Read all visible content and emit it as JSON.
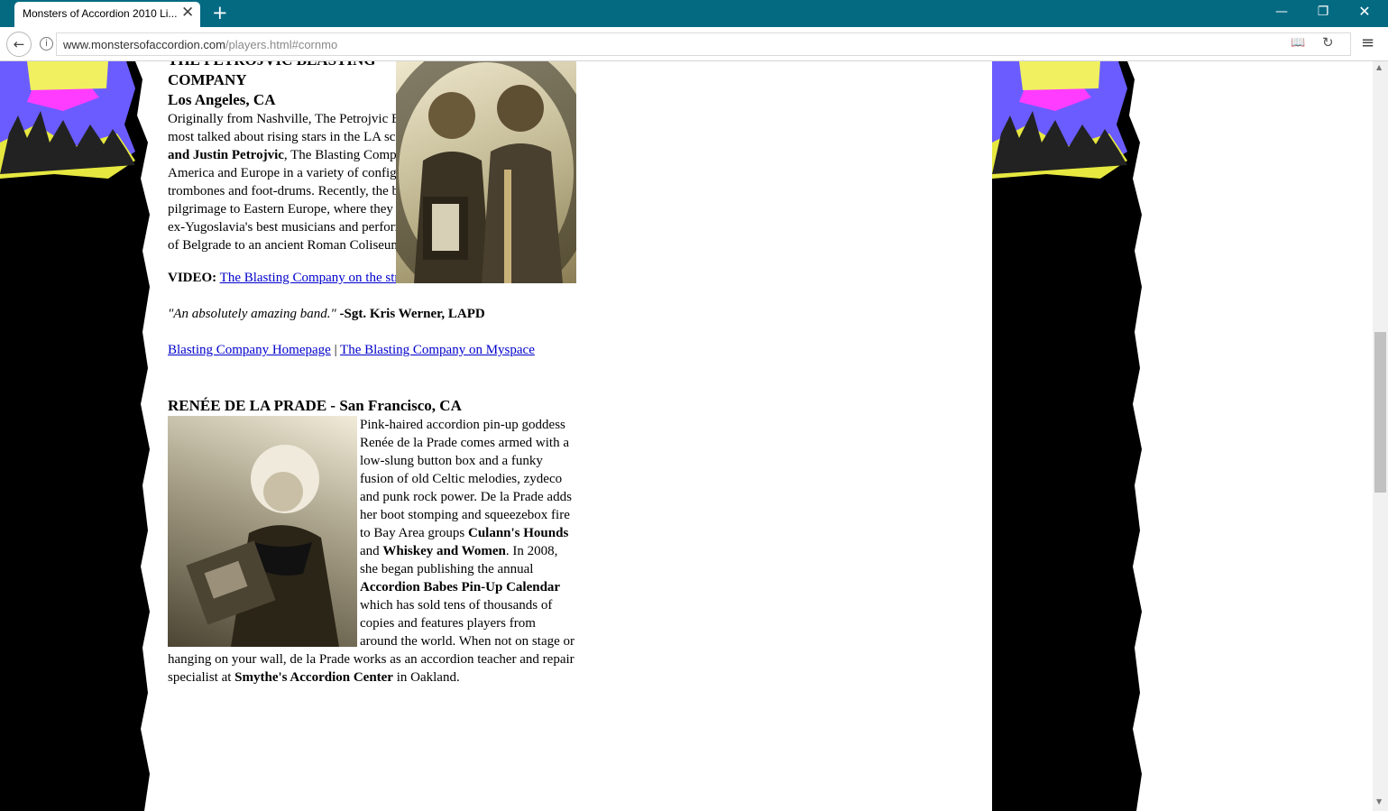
{
  "browser": {
    "tab_title": "Monsters of Accordion 2010 Li...",
    "url_host": "www.monstersofaccordion.com",
    "url_path": "/players.html#cornmo",
    "icons": [
      "close-icon",
      "plus-icon",
      "minimize-icon",
      "restore-icon",
      "close-window-icon",
      "back-arrow-icon",
      "info-icon",
      "reader-icon",
      "reload-icon",
      "menu-icon"
    ]
  },
  "article": {
    "band1": {
      "name_line1": "THE PETROJVIC BLASTING",
      "name_line2": "COMPANY",
      "city": "Los Angeles, CA",
      "bio_a": "Originally from Nashville, The Petrojvic Blasting Company are one of the most talked about rising stars in the LA scene. Founded by brothers ",
      "bio_bold": "Josh and Justin Petrojvic",
      "bio_b": ", The Blasting Company have travelled across North America and Europe in a variety of configurations with their accordions, trombones and foot-drums. Recently, the brothers returned from a pilgrimage to Eastern Europe, where they shared the stage with some of ex-Yugoslavia's best musicians and performed everywhere from the streets of Belgrade to an ancient Roman Coliseum.",
      "video_label": "VIDEO:",
      "video_link": "The Blasting Company on the streets of LA",
      "video_end": ".",
      "quote": "\"An absolutely amazing band.\"",
      "quote_source": " -Sgt. Kris Werner, LAPD",
      "homepage_link": "Blasting Company Homepage",
      "separator": " | ",
      "myspace_link": "The Blasting Company on Myspace"
    },
    "band2": {
      "heading": "RENÉE DE LA PRADE - San Francisco, CA",
      "bio_a": "Pink-haired accordion pin-up goddess Renée de la Prade comes armed with a low-slung button box and a funky fusion of old Celtic melodies, zydeco and punk rock power. De la Prade adds her boot stomping and squeezebox fire to Bay Area groups ",
      "bold1": "Culann's Hounds",
      "and": " and ",
      "bold2": "Whiskey and Women",
      "bio_b": ". In 2008, she began publishing the annual ",
      "bold3": "Accordion Babes Pin-Up Calendar",
      "bio_c": " which has sold tens of thousands of copies and features players from around the world. When not on stage or hanging on your wall, de la Prade works as an accordion teacher and repair specialist at ",
      "bold4": "Smythe's Accordion Center",
      "bio_d": " in Oakland."
    }
  }
}
